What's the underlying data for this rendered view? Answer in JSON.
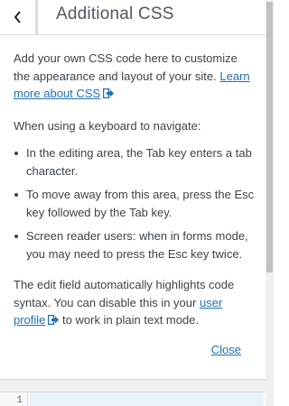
{
  "header": {
    "back_icon": "chevron-left-icon",
    "title": "Additional CSS"
  },
  "help": {
    "intro": "Add your own CSS code here to customize the appearance and layout of your site.",
    "learn_more_link": "Learn more about CSS",
    "keyboard_intro": "When using a keyboard to navigate:",
    "bullets": [
      "In the editing area, the Tab key enters a tab character.",
      "To move away from this area, press the Esc key followed by the Tab key.",
      "Screen reader users: when in forms mode, you may need to press the Esc key twice."
    ],
    "syntax_before": "The edit field automatically highlights code syntax. You can disable this in your",
    "syntax_link": "user profile",
    "syntax_after": "to work in plain text mode.",
    "close_label": "Close",
    "external_icon": "external-link-icon"
  },
  "editor": {
    "line_number": "1"
  },
  "colors": {
    "link": "#2271b1",
    "text": "#3c434a",
    "border": "#dcdcde",
    "active_line": "#e8f2fb"
  }
}
